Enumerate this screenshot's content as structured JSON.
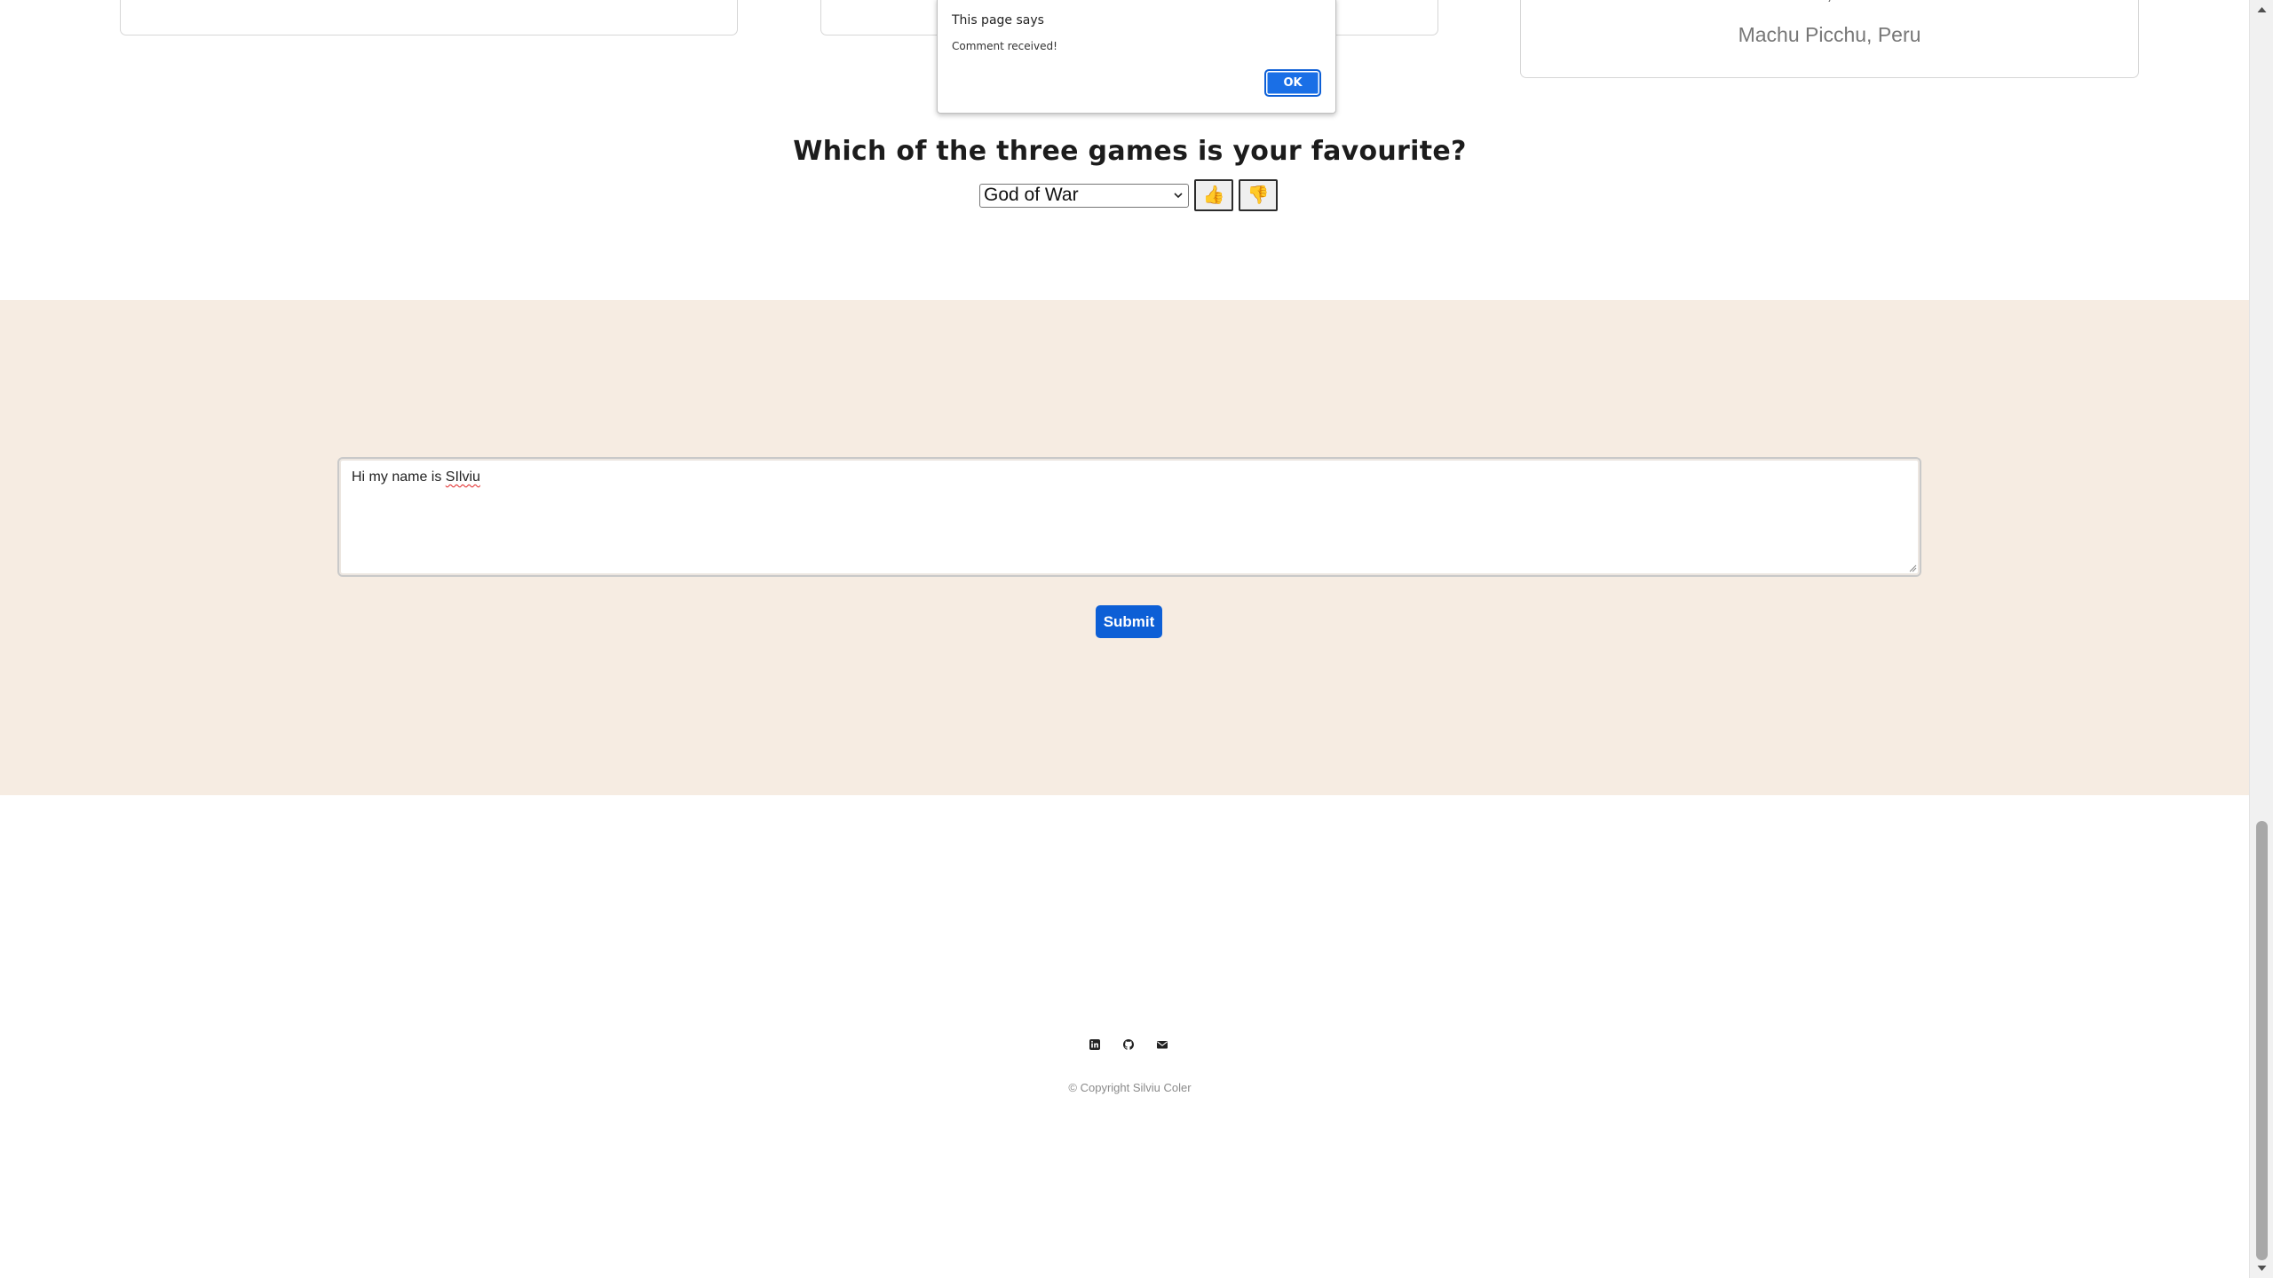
{
  "cards": [
    {
      "caption": ""
    },
    {
      "caption": ""
    },
    {
      "caption": "Machu Picchu, Peru"
    }
  ],
  "games": {
    "question": "Which of the three games is your favourite?",
    "selected": "God of War",
    "thumbs_up": "👍",
    "thumbs_down": "👎"
  },
  "comment": {
    "text_prefix": "Hi my name is ",
    "text_misspelled": "SIlviu",
    "submit_label": "Submit"
  },
  "footer": {
    "icons": [
      "linkedin-icon",
      "github-icon",
      "email-icon"
    ],
    "copyright": "© Copyright Silviu Coler"
  },
  "alert": {
    "title": "This page says",
    "message": "Comment received!",
    "ok_label": "OK"
  },
  "colors": {
    "comment_bg": "#f6ece2",
    "submit_bg": "#0d5fd6",
    "ok_bg": "#1a6fe6"
  }
}
